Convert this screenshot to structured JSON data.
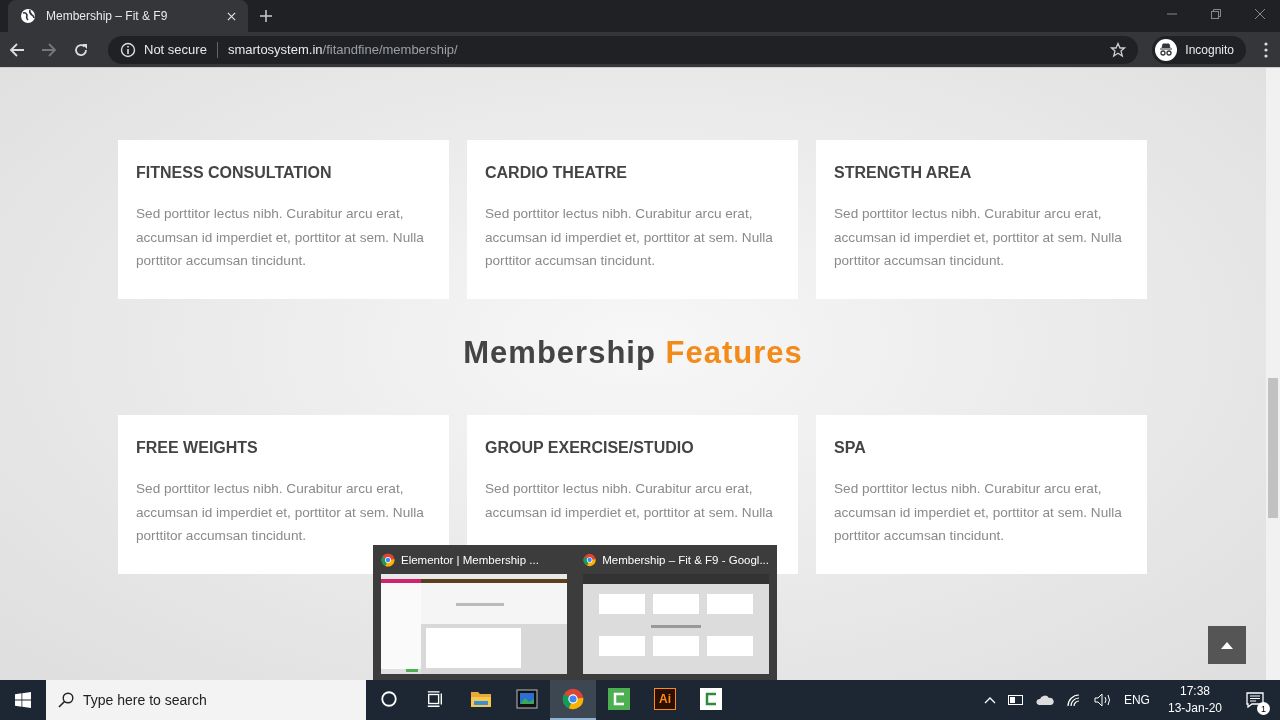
{
  "browser": {
    "tab_title": "Membership – Fit & F9",
    "security": "Not secure",
    "host": "smartosystem.in",
    "path": "/fitandfine/membership/",
    "profile": "Incognito"
  },
  "cards_top": [
    {
      "title": "FITNESS CONSULTATION",
      "text": "Sed porttitor lectus nibh. Curabitur arcu erat, accumsan id imperdiet et, porttitor at sem. Nulla porttitor accumsan tincidunt."
    },
    {
      "title": "CARDIO THEATRE",
      "text": "Sed porttitor lectus nibh. Curabitur arcu erat, accumsan id imperdiet et, porttitor at sem. Nulla porttitor accumsan tincidunt."
    },
    {
      "title": "STRENGTH AREA",
      "text": "Sed porttitor lectus nibh. Curabitur arcu erat, accumsan id imperdiet et, porttitor at sem. Nulla porttitor accumsan tincidunt."
    }
  ],
  "heading": {
    "main": "Membership",
    "accent": "Features"
  },
  "cards_bottom": [
    {
      "title": "FREE WEIGHTS",
      "text": "Sed porttitor lectus nibh. Curabitur arcu erat, accumsan id imperdiet et, porttitor at sem. Nulla porttitor accumsan tincidunt."
    },
    {
      "title": "GROUP EXERCISE/STUDIO",
      "text": "Sed porttitor lectus nibh. Curabitur arcu erat, accumsan id imperdiet et, porttitor at sem. Nulla"
    },
    {
      "title": "SPA",
      "text": "Sed porttitor lectus nibh. Curabitur arcu erat, accumsan id imperdiet et, porttitor at sem. Nulla porttitor accumsan tincidunt."
    }
  ],
  "previews": [
    {
      "title": "Elementor | Membership ...",
      "kind": "picture"
    },
    {
      "title": "Membership – Fit & F9 - Googl...",
      "kind": "picture"
    }
  ],
  "taskbar": {
    "search_placeholder": "Type here to search",
    "apps": [
      {
        "kind": "cortana",
        "selected": false
      },
      {
        "kind": "taskview",
        "selected": false
      },
      {
        "kind": "explorer",
        "selected": false
      },
      {
        "kind": "window",
        "selected": false
      },
      {
        "kind": "chrome",
        "selected": true
      },
      {
        "kind": "camtasia",
        "selected": false
      },
      {
        "kind": "illustrator",
        "label": "Ai",
        "selected": false
      },
      {
        "kind": "recorder",
        "selected": false
      }
    ],
    "language": "ENG",
    "time": "17:38",
    "date": "13-Jan-20",
    "notifications": "1"
  }
}
